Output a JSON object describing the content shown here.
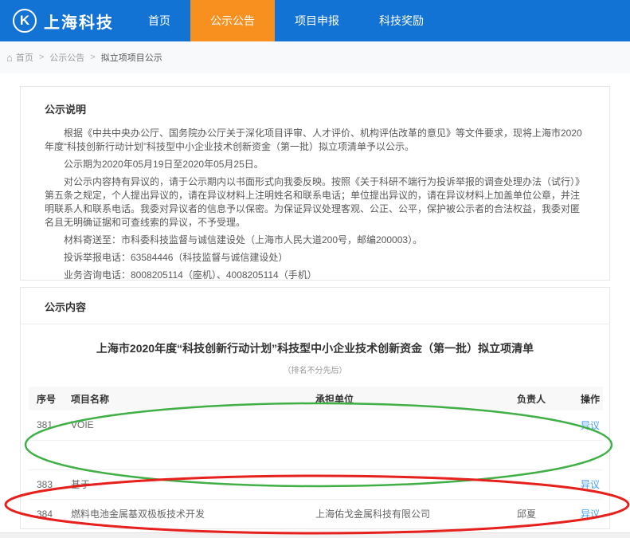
{
  "header": {
    "logo_icon": "K",
    "logo_text": "上海科技",
    "nav": [
      {
        "label": "首页"
      },
      {
        "label": "公示公告"
      },
      {
        "label": "项目申报"
      },
      {
        "label": "科技奖励"
      }
    ]
  },
  "breadcrumb": {
    "separator": ">",
    "items": [
      "首页",
      "公示公告",
      "拟立项项目公示"
    ]
  },
  "notice": {
    "title": "公示说明",
    "paragraphs": [
      "根据《中共中央办公厅、国务院办公厅关于深化项目评审、人才评价、机构评估改革的意见》等文件要求，现将上海市2020年度“科技创新行动计划”科技型中小企业技术创新资金（第一批）拟立项清单予以公示。",
      "公示期为2020年05月19日至2020年05月25日。",
      "对公示内容持有异议的，请于公示期内以书面形式向我委反映。按照《关于科研不端行为投诉举报的调查处理办法（试行）》第五条之规定，个人提出异议的，请在异议材料上注明姓名和联系电话；单位提出异议的，请在异议材料上加盖单位公章，并注明联系人和联系电话。我委对异议者的信息予以保密。为保证异议处理客观、公正、公平，保护被公示者的合法权益，我委对匿名且无明确证据和可查线索的异议，不予受理。",
      "材料寄送至：市科委科技监督与诚信建设处（上海市人民大道200号，邮编200003）。",
      "投诉举报电话：63584446（科技监督与诚信建设处）",
      "业务咨询电话：8008205114（座机）、4008205114（手机）"
    ]
  },
  "content": {
    "title": "公示内容",
    "list_title": "上海市2020年度“科技创新行动计划”科技型中小企业技术创新资金（第一批）拟立项清单",
    "list_subtitle": "（排名不分先后）",
    "columns": [
      "序号",
      "项目名称",
      "承担单位",
      "负责人",
      "操作"
    ],
    "rows": [
      {
        "no": "381",
        "name": "VOIE",
        "unit": "",
        "leader": "",
        "action": "异议"
      },
      {
        "no": "",
        "name": "",
        "unit": "",
        "leader": "",
        "action": ""
      },
      {
        "no": "383",
        "name": "基于",
        "unit": "",
        "leader": "",
        "action": "异议"
      },
      {
        "no": "384",
        "name": "燃料电池金属基双极板技术开发",
        "unit": "上海佑戈金属科技有限公司",
        "leader": "邱夏",
        "action": "异议"
      }
    ]
  },
  "annotations": {
    "green_ellipse": {
      "color": "#3faf46"
    },
    "red_ellipse": {
      "color": "#e6201c"
    }
  },
  "colors": {
    "header_blue": "#1373d5",
    "active_tab_orange": "#f7901e",
    "link_blue": "#409eff"
  }
}
